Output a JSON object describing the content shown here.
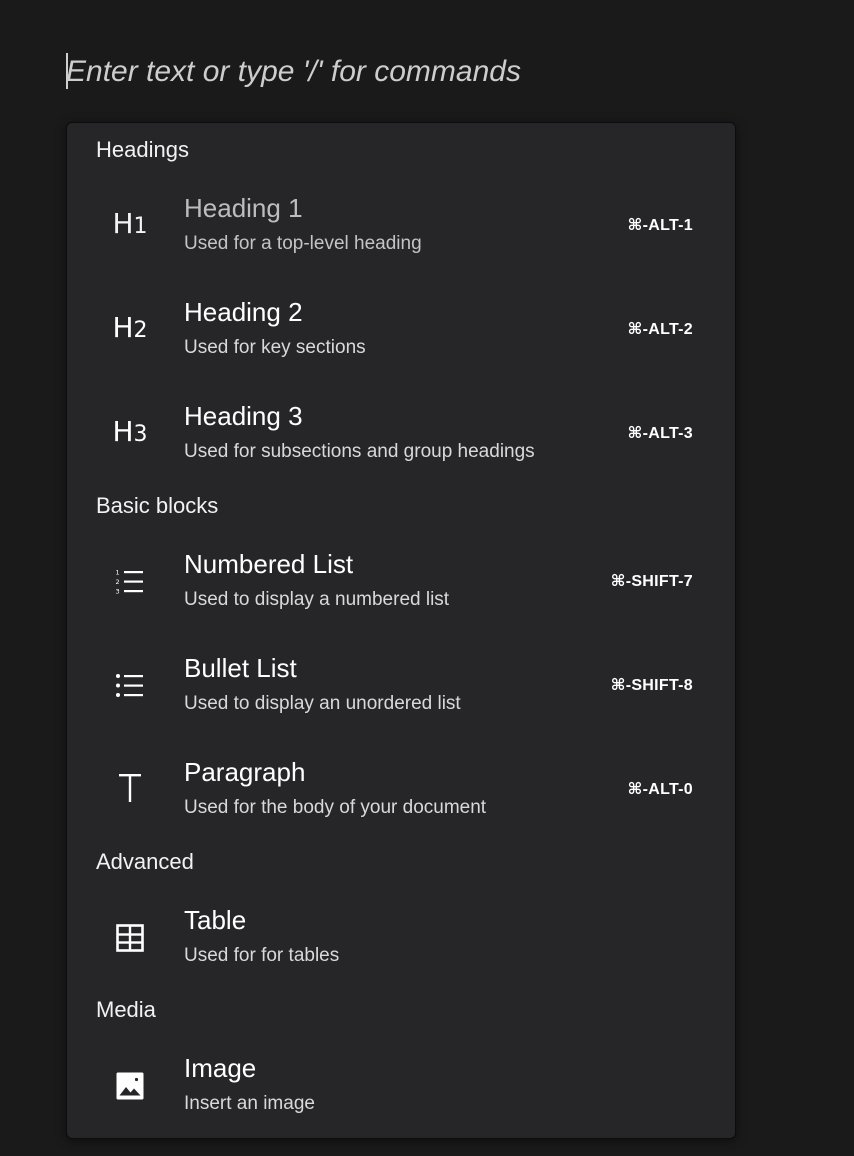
{
  "editor": {
    "placeholder": "Enter text or type '/' for commands"
  },
  "menu": {
    "sections": [
      {
        "title": "Headings",
        "items": [
          {
            "icon": "heading-1-icon",
            "title": "Heading 1",
            "description": "Used for a top-level heading",
            "shortcut": "⌘-ALT-1"
          },
          {
            "icon": "heading-2-icon",
            "title": "Heading 2",
            "description": "Used for key sections",
            "shortcut": "⌘-ALT-2"
          },
          {
            "icon": "heading-3-icon",
            "title": "Heading 3",
            "description": "Used for subsections and group headings",
            "shortcut": "⌘-ALT-3"
          }
        ]
      },
      {
        "title": "Basic blocks",
        "items": [
          {
            "icon": "numbered-list-icon",
            "title": "Numbered List",
            "description": "Used to display a numbered list",
            "shortcut": "⌘-SHIFT-7"
          },
          {
            "icon": "bullet-list-icon",
            "title": "Bullet List",
            "description": "Used to display an unordered list",
            "shortcut": "⌘-SHIFT-8"
          },
          {
            "icon": "paragraph-icon",
            "title": "Paragraph",
            "description": "Used for the body of your document",
            "shortcut": "⌘-ALT-0"
          }
        ]
      },
      {
        "title": "Advanced",
        "items": [
          {
            "icon": "table-icon",
            "title": "Table",
            "description": "Used for for tables",
            "shortcut": ""
          }
        ]
      },
      {
        "title": "Media",
        "items": [
          {
            "icon": "image-icon",
            "title": "Image",
            "description": "Insert an image",
            "shortcut": ""
          }
        ]
      }
    ]
  }
}
